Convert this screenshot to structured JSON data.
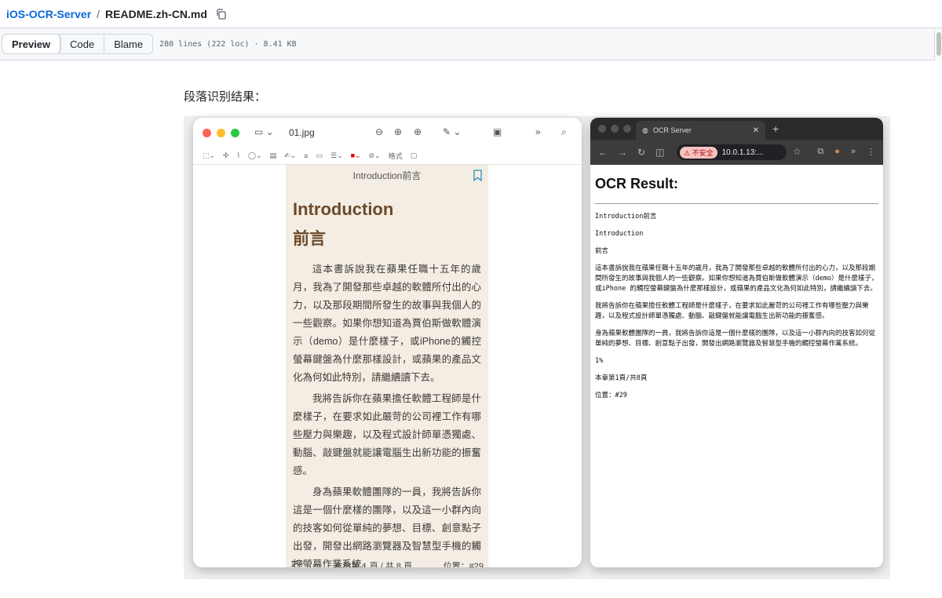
{
  "breadcrumb": {
    "repo": "iOS-OCR-Server",
    "separator": "/",
    "file": "README.zh-CN.md"
  },
  "toolbar": {
    "tabs": [
      "Preview",
      "Code",
      "Blame"
    ],
    "file_info": "280 lines (222 loc) · 8.41 KB"
  },
  "content": {
    "heading": "段落识别结果："
  },
  "preview_window": {
    "filename": "01.jpg",
    "page_header": "Introduction前言",
    "title_en": "Introduction",
    "title_zh": "前言",
    "paragraphs": [
      "這本書訴說我在蘋果任職十五年的歲月，我為了開發那些卓越的軟體所付出的心力，以及那段期間所發生的故事與我個人的一些觀察。如果你想知道為賈伯斯做軟體演示（demo）是什麼樣子，或iPhone的觸控螢幕鍵盤為什麼那樣設計，或蘋果的產品文化為何如此特別，請繼續讀下去。",
      "我將告訴你在蘋果擔任軟體工程師是什麼樣子，在要求如此嚴苛的公司裡工作有哪些壓力與樂趣，以及程式設計師單憑獨處、動腦、敲鍵盤就能讓電腦生出新功能的振奮感。",
      "身為蘋果軟體團隊的一員，我將告訴你這是一個什麼樣的團隊，以及這一小群內向的技客如何從單純的夢想、目標、創意點子出發，開發出網路瀏覽器及智慧型手機的觸控螢幕作業系統。"
    ],
    "footer_left": "1%",
    "footer_mid": "本章第 1 頁 / 共 8 頁",
    "footer_right": "位置：#29",
    "tool_label": "格式"
  },
  "browser_window": {
    "tab_title": "OCR Server",
    "insecure_label": "不安全",
    "url": "10.0.1.13:...",
    "result_title": "OCR Result:",
    "lines": [
      "Introduction前言",
      "Introduction",
      "前言",
      "這本書訴說我在蘋果任職十五年的歲月，我為了開發那些卓越的軟體所付出的心力，以及那段期間所發生的故事與我個人的一些觀察。如果你想知道為賈伯斯做軟體演示（demo）是什麼樣子，或iPhone 的觸控螢幕鍵盤為什麼那樣設計，或蘋果的產品文化為何如此特別，請繼續讀下去。",
      "我將告訴你在蘋果擔任軟體工程師是什麼樣子，在要求如此嚴苛的公司裡工作有哪些壓力與樂趣，以及程式設計師單憑獨處、動腦、敲鍵盤就能讓電腦生出新功能的振奮感。",
      "身為蘋果軟體團隊的一員，我將告訴你這是一個什麼樣的團隊，以及這一小群內向的技客如何從單純的夢想、目標、創意點子出發，開發出網路瀏覽器及智慧型手機的觸控螢幕作業系統。",
      "1%",
      "本章第1頁/共8頁",
      "位置：#29"
    ]
  },
  "colors": {
    "link": "#0969da",
    "page_bg": "#f3ede3",
    "heading_brown": "#6b4a2a"
  }
}
